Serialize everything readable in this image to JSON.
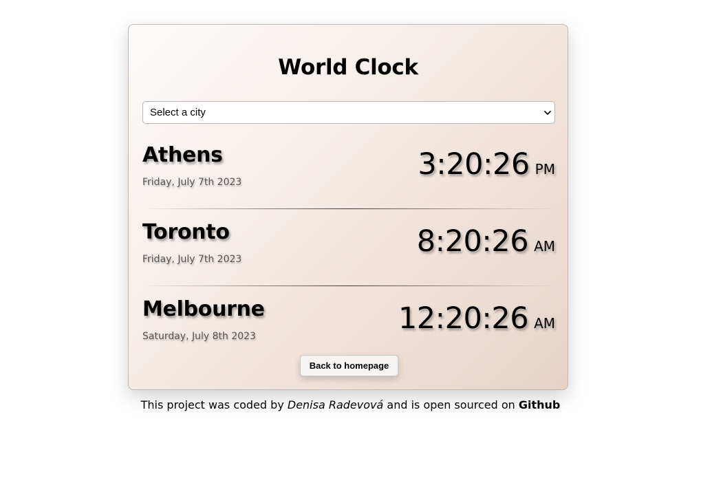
{
  "title": "World Clock",
  "city_select": {
    "selected": "Select a city"
  },
  "cities": [
    {
      "name": "Athens",
      "date": "Friday, July 7th 2023",
      "time": "3:20:26",
      "ampm": "PM"
    },
    {
      "name": "Toronto",
      "date": "Friday, July 7th 2023",
      "time": "8:20:26",
      "ampm": "AM"
    },
    {
      "name": "Melbourne",
      "date": "Saturday, July 8th 2023",
      "time": "12:20:26",
      "ampm": "AM"
    }
  ],
  "back_button": "Back to homepage",
  "footer": {
    "prefix": "This project was coded by ",
    "author": "Denisa Radevová",
    "middle": " and is open sourced on ",
    "link": "Github"
  },
  "icons": {
    "select_arrow": "chevron-down-icon"
  }
}
